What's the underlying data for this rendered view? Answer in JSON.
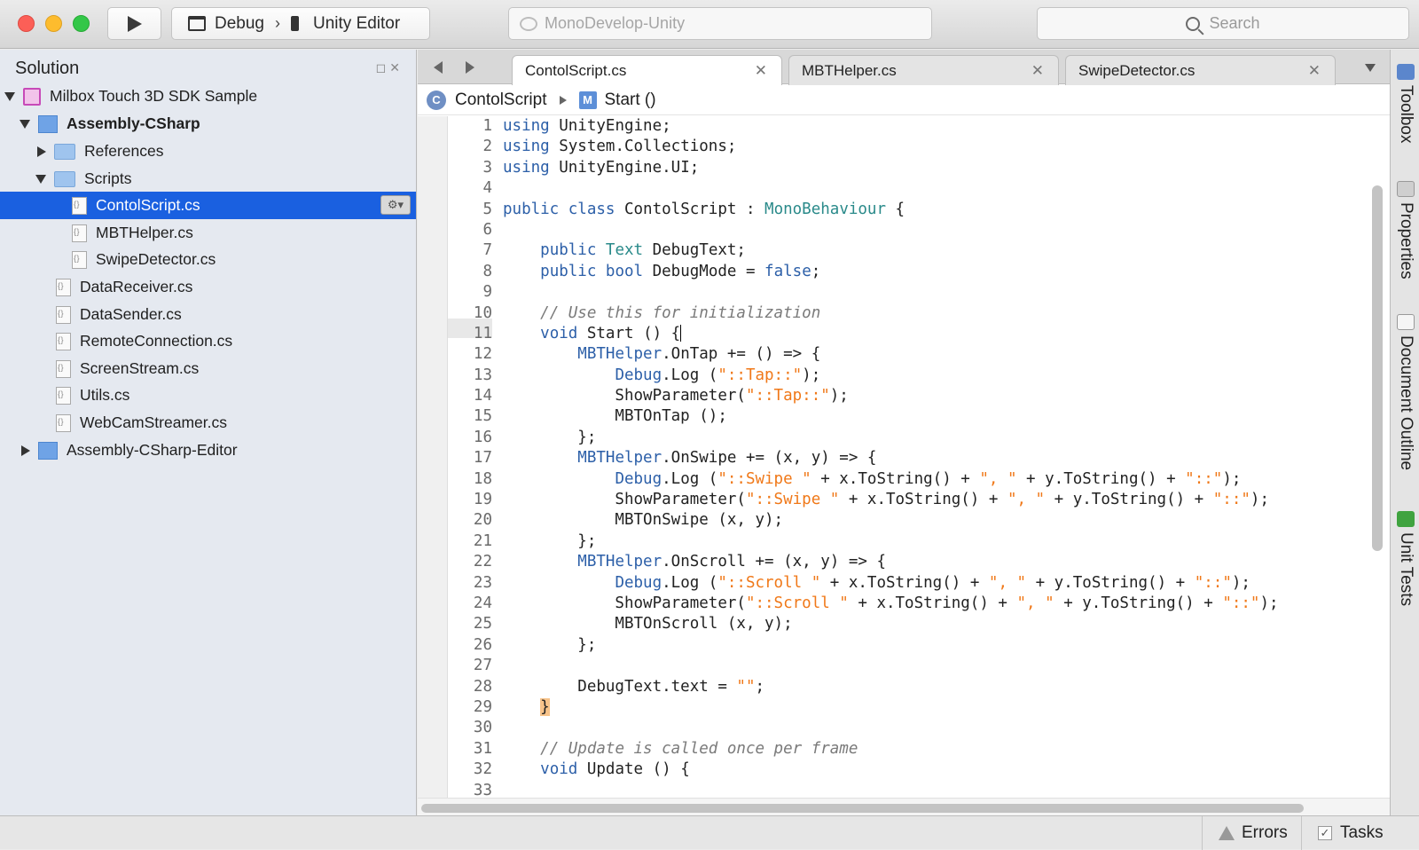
{
  "toolbar": {
    "configuration": "Debug",
    "target": "Unity Editor",
    "status_text": "MonoDevelop-Unity",
    "search_placeholder": "Search"
  },
  "solution_panel": {
    "title": "Solution",
    "items": [
      {
        "label": "Milbox Touch 3D SDK Sample",
        "bold": false
      },
      {
        "label": "Assembly-CSharp",
        "bold": true
      },
      {
        "label": "References",
        "bold": false
      },
      {
        "label": "Scripts",
        "bold": false
      },
      {
        "label": "ContolScript.cs",
        "bold": false
      },
      {
        "label": "MBTHelper.cs",
        "bold": false
      },
      {
        "label": "SwipeDetector.cs",
        "bold": false
      },
      {
        "label": "DataReceiver.cs",
        "bold": false
      },
      {
        "label": "DataSender.cs",
        "bold": false
      },
      {
        "label": "RemoteConnection.cs",
        "bold": false
      },
      {
        "label": "ScreenStream.cs",
        "bold": false
      },
      {
        "label": "Utils.cs",
        "bold": false
      },
      {
        "label": "WebCamStreamer.cs",
        "bold": false
      },
      {
        "label": "Assembly-CSharp-Editor",
        "bold": false
      }
    ]
  },
  "tabs": [
    {
      "label": "ContolScript.cs",
      "active": true
    },
    {
      "label": "MBTHelper.cs",
      "active": false
    },
    {
      "label": "SwipeDetector.cs",
      "active": false
    }
  ],
  "breadcrumb": {
    "class_name": "ContolScript",
    "method_name": "Start ()"
  },
  "code": {
    "line_numbers": [
      "1",
      "2",
      "3",
      "4",
      "5",
      "6",
      "7",
      "8",
      "9",
      "10",
      "11",
      "12",
      "13",
      "14",
      "15",
      "16",
      "17",
      "18",
      "19",
      "20",
      "21",
      "22",
      "23",
      "24",
      "25",
      "26",
      "27",
      "28",
      "29",
      "30",
      "31",
      "32",
      "33"
    ],
    "lines": [
      "using UnityEngine;",
      "using System.Collections;",
      "using UnityEngine.UI;",
      "",
      "public class ContolScript : MonoBehaviour {",
      "",
      "    public Text DebugText;",
      "    public bool DebugMode = false;",
      "",
      "    // Use this for initialization",
      "    void Start () {",
      "        MBTHelper.OnTap += () => {",
      "            Debug.Log (\"::Tap::\");",
      "            ShowParameter(\"::Tap::\");",
      "            MBTOnTap ();",
      "        };",
      "        MBTHelper.OnSwipe += (x, y) => {",
      "            Debug.Log (\"::Swipe \" + x.ToString() + \", \" + y.ToString() + \"::\");",
      "            ShowParameter(\"::Swipe \" + x.ToString() + \", \" + y.ToString() + \"::\");",
      "            MBTOnSwipe (x, y);",
      "        };",
      "        MBTHelper.OnScroll += (x, y) => {",
      "            Debug.Log (\"::Scroll \" + x.ToString() + \", \" + y.ToString() + \"::\");",
      "            ShowParameter(\"::Scroll \" + x.ToString() + \", \" + y.ToString() + \"::\");",
      "            MBTOnScroll (x, y);",
      "        };",
      "",
      "        DebugText.text = \"\";",
      "    }",
      "",
      "    // Update is called once per frame",
      "    void Update () {",
      ""
    ]
  },
  "dock": {
    "toolbox": "Toolbox",
    "properties": "Properties",
    "document_outline": "Document Outline",
    "unit_tests": "Unit Tests"
  },
  "statusbar": {
    "errors": "Errors",
    "tasks": "Tasks"
  },
  "colors": {
    "selection": "#1a60e0",
    "keyword": "#2c5fa8",
    "type": "#2a8a8a",
    "string": "#f07818",
    "comment": "#7a7a7a"
  }
}
